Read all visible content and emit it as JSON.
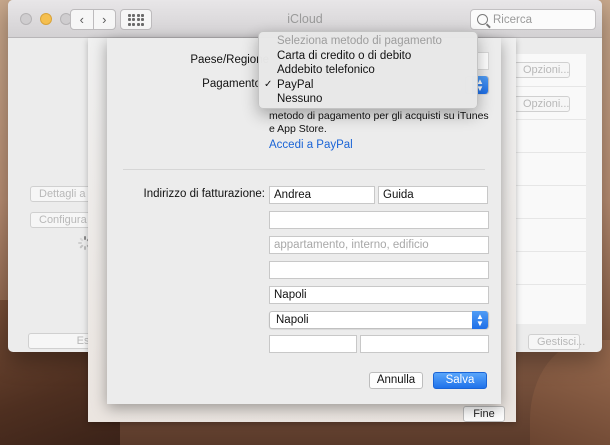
{
  "window": {
    "title": "iCloud",
    "search_placeholder": "Ricerca",
    "nav_back": "‹",
    "nav_forward": "›"
  },
  "background": {
    "left_buttons": [
      "Dettagli a",
      "Configura",
      "Esc"
    ],
    "right_buttons": [
      "Opzioni...",
      "Opzioni...",
      "Gestisci..."
    ]
  },
  "form": {
    "country_label": "Paese/Regione",
    "payment_label": "Pagamento",
    "payment_info": "metodo di pagamento per gli acquisti su iTunes e App Store.",
    "paypal_link": "Accedi a PayPal",
    "billing_label": "Indirizzo di fatturazione:",
    "first_name": "Andrea",
    "last_name": "Guida",
    "street_value": "",
    "apartment_placeholder": "appartamento, interno, edificio",
    "address_line3_value": "",
    "city": "Napoli",
    "province": "Napoli",
    "postal_code_value": "",
    "phone_value": "",
    "cancel_label": "Annulla",
    "save_label": "Salva"
  },
  "outer_sheet": {
    "done_label": "Fine"
  },
  "payment_menu": {
    "header": "Seleziona metodo di pagamento",
    "items": [
      {
        "label": "Carta di credito o di debito",
        "checked": false
      },
      {
        "label": "Addebito telefonico",
        "checked": false
      },
      {
        "label": "PayPal",
        "checked": true
      },
      {
        "label": "Nessuno",
        "checked": false
      }
    ],
    "check_glyph": "✓"
  },
  "colors": {
    "accent": "#1f72ea",
    "link": "#1a64d6",
    "minimize": "#f5bf4f"
  }
}
